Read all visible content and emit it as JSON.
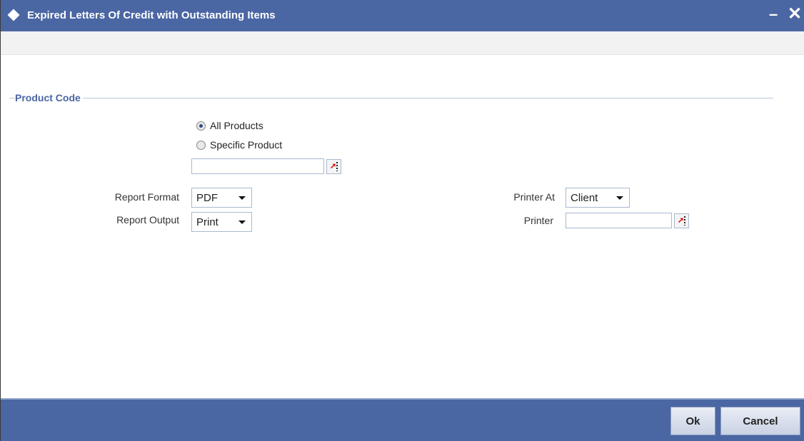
{
  "window": {
    "title": "Expired Letters Of Credit with Outstanding Items",
    "minimize_glyph": "–",
    "close_glyph": "✕"
  },
  "product_code": {
    "legend": "Product Code",
    "options": [
      {
        "label": "All Products",
        "checked": true
      },
      {
        "label": "Specific Product",
        "checked": false
      }
    ],
    "specific_product_value": ""
  },
  "report": {
    "format_label": "Report Format",
    "format_value": "PDF",
    "output_label": "Report Output",
    "output_value": "Print",
    "printer_at_label": "Printer At",
    "printer_at_value": "Client",
    "printer_label": "Printer",
    "printer_value": ""
  },
  "footer": {
    "ok_label": "Ok",
    "cancel_label": "Cancel"
  },
  "icons": {
    "lookup": "lookup-icon"
  },
  "colors": {
    "titlebar": "#4a66a3",
    "footer": "#4a66a3",
    "legend": "#4a66a3"
  }
}
